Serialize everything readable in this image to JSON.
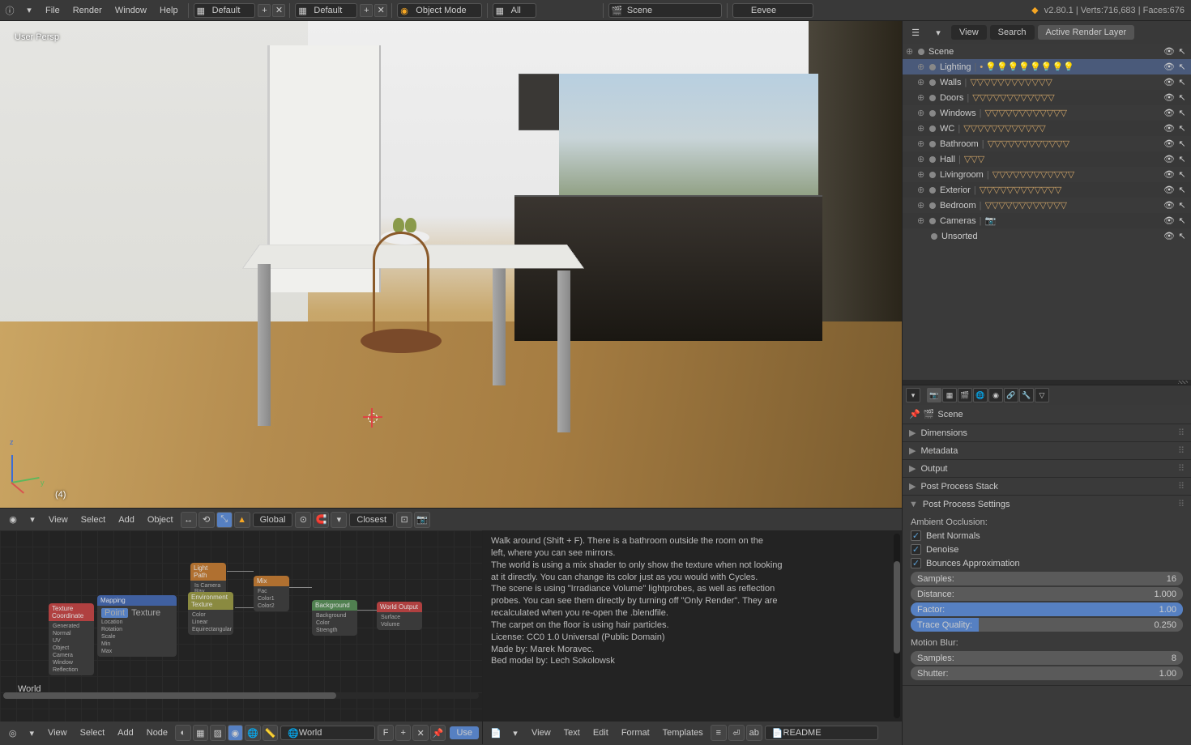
{
  "topbar": {
    "menus": [
      "File",
      "Render",
      "Window",
      "Help"
    ],
    "dd1": "Default",
    "dd2": "Default",
    "mode": "Object Mode",
    "layers": "All",
    "scene": "Scene",
    "engine": "Eevee",
    "version": "v2.80.1",
    "stats": "Verts:716,683 | Faces:676"
  },
  "viewport": {
    "label": "User Persp",
    "num": "(4)",
    "toolbar": {
      "view": "View",
      "select": "Select",
      "add": "Add",
      "object": "Object",
      "orient": "Global",
      "snap": "Closest"
    }
  },
  "node": {
    "world": "World",
    "toolbar": {
      "view": "View",
      "select": "Select",
      "add": "Add",
      "node": "Node",
      "world": "World",
      "f": "F",
      "use": "Use"
    },
    "nodes": {
      "texcoord": "Texture Coordinate",
      "mapping": "Mapping",
      "lightpath": "Light Path",
      "env": "Environment Texture",
      "mix": "Mix",
      "bg": "Background",
      "out": "World Output"
    }
  },
  "text": {
    "lines": [
      "Walk around (Shift + F). There is a bathroom outside the room on the",
      "left, where you can see mirrors.",
      "",
      "The world is using a mix shader to only show the texture when not looking",
      "at it directly. You can change its color just as you would with Cycles.",
      "",
      "The scene is using \"Irradiance Volume\" lightprobes, as well as reflection",
      "probes. You can see them directly by turning off \"Only Render\". They are",
      "recalculated when you re-open the .blendfile.",
      "",
      "The carpet on the floor is using hair particles.",
      "",
      "License: CC0 1.0 Universal (Public Domain)",
      "",
      "Made by: Marek Moravec.",
      "Bed model by: Lech Sokolowsk"
    ],
    "toolbar": {
      "view": "View",
      "text": "Text",
      "edit": "Edit",
      "format": "Format",
      "templates": "Templates",
      "file": "README"
    }
  },
  "outliner": {
    "tabs": {
      "view": "View",
      "search": "Search",
      "active": "Active Render Layer"
    },
    "items": [
      {
        "label": "Scene",
        "type": "scene"
      },
      {
        "label": "Lighting",
        "type": "coll",
        "sel": true,
        "icons": "lights"
      },
      {
        "label": "Walls",
        "type": "coll",
        "icons": "mesh"
      },
      {
        "label": "Doors",
        "type": "coll",
        "icons": "mesh"
      },
      {
        "label": "Windows",
        "type": "coll",
        "icons": "mesh"
      },
      {
        "label": "WC",
        "type": "coll",
        "icons": "mesh"
      },
      {
        "label": "Bathroom",
        "type": "coll",
        "icons": "mesh"
      },
      {
        "label": "Hall",
        "type": "coll",
        "icons": "mesh3"
      },
      {
        "label": "Livingroom",
        "type": "coll",
        "icons": "mesh"
      },
      {
        "label": "Exterior",
        "type": "coll",
        "icons": "mesh"
      },
      {
        "label": "Bedroom",
        "type": "coll",
        "icons": "mesh"
      },
      {
        "label": "Cameras",
        "type": "coll",
        "icons": "cam"
      },
      {
        "label": "Unsorted",
        "type": "item"
      }
    ]
  },
  "props": {
    "crumb": "Scene",
    "panels": {
      "dimensions": "Dimensions",
      "metadata": "Metadata",
      "output": "Output",
      "postStack": "Post Process Stack",
      "postSettings": "Post Process Settings"
    },
    "ao": {
      "title": "Ambient Occlusion:",
      "bent": "Bent Normals",
      "denoise": "Denoise",
      "bounces": "Bounces Approximation",
      "samples_l": "Samples:",
      "samples_v": "16",
      "distance_l": "Distance:",
      "distance_v": "1.000",
      "factor_l": "Factor:",
      "factor_v": "1.00",
      "trace_l": "Trace Quality:",
      "trace_v": "0.250"
    },
    "mb": {
      "title": "Motion Blur:",
      "samples_l": "Samples:",
      "samples_v": "8",
      "shutter_l": "Shutter:",
      "shutter_v": "1.00"
    }
  }
}
